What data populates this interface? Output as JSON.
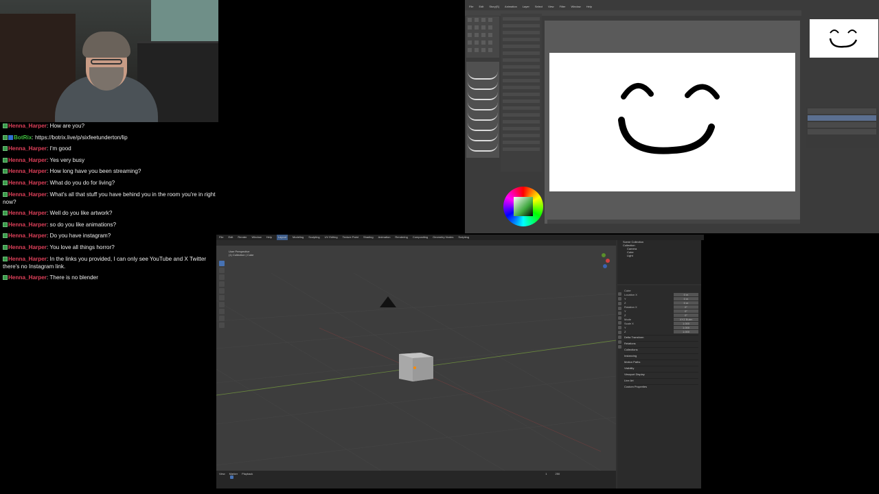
{
  "chat": {
    "messages": [
      {
        "user": "Henna_Harper",
        "text": "How are you?"
      },
      {
        "user": "BotRix",
        "text": "https://botrix.live/p/sixfeetunderton/lip"
      },
      {
        "user": "Henna_Harper",
        "text": "I'm good"
      },
      {
        "user": "Henna_Harper",
        "text": "Yes very busy"
      },
      {
        "user": "Henna_Harper",
        "text": "How long have you been streaming?"
      },
      {
        "user": "Henna_Harper",
        "text": "What do you do for living?"
      },
      {
        "user": "Henna_Harper",
        "text": "What's all that stuff you have behind you in the room you're in right now?"
      },
      {
        "user": "Henna_Harper",
        "text": "Well do you like artwork?"
      },
      {
        "user": "Henna_Harper",
        "text": "so do you like animations?"
      },
      {
        "user": "Henna_Harper",
        "text": "Do you have instagram?"
      },
      {
        "user": "Henna_Harper",
        "text": "You love all things horror?"
      },
      {
        "user": "Henna_Harper",
        "text": "In the links you provided, I can only see YouTube and X Twitter there's no Instagram link."
      },
      {
        "user": "Henna_Harper",
        "text": "There is no blender"
      }
    ]
  },
  "csp": {
    "menu": [
      "File",
      "Edit",
      "Story(S)",
      "Animation",
      "Layer",
      "Select",
      "View",
      "Filter",
      "Window",
      "Help"
    ],
    "colors": {
      "panel": "#3b3b3b",
      "canvas": "#ffffff",
      "accent": "#5b6f90"
    }
  },
  "blender": {
    "workspaces": [
      "File",
      "Edit",
      "Render",
      "Window",
      "Help",
      "Layout",
      "Modeling",
      "Sculpting",
      "UV Editing",
      "Texture Paint",
      "Shading",
      "Animation",
      "Rendering",
      "Compositing",
      "Geometry Nodes",
      "Scripting"
    ],
    "viewport_title": "User Perspective",
    "viewport_subtitle": "(1) Collection | Cube",
    "outliner": [
      {
        "label": "Scene Collection",
        "indent": false
      },
      {
        "label": "Collection",
        "indent": false
      },
      {
        "label": "Camera",
        "indent": true
      },
      {
        "label": "Cube",
        "indent": true
      },
      {
        "label": "Light",
        "indent": true
      }
    ],
    "object_name": "Cube",
    "transform": [
      {
        "label": "Location X",
        "value": "0 m"
      },
      {
        "label": "Y",
        "value": "0 m"
      },
      {
        "label": "Z",
        "value": "0 m"
      },
      {
        "label": "Rotation X",
        "value": "0°"
      },
      {
        "label": "Y",
        "value": "0°"
      },
      {
        "label": "Z",
        "value": "0°"
      },
      {
        "label": "Mode",
        "value": "XYZ Euler"
      },
      {
        "label": "Scale X",
        "value": "1.000"
      },
      {
        "label": "Y",
        "value": "1.000"
      },
      {
        "label": "Z",
        "value": "1.000"
      }
    ],
    "sections": [
      "Delta Transform",
      "Relations",
      "Collections",
      "Instancing",
      "Motion Paths",
      "Visibility",
      "Viewport Display",
      "Line Art",
      "Custom Properties"
    ],
    "timeline": [
      "View",
      "Marker",
      "Playback"
    ],
    "timeline_frames": {
      "start": "1",
      "end": "250"
    }
  }
}
